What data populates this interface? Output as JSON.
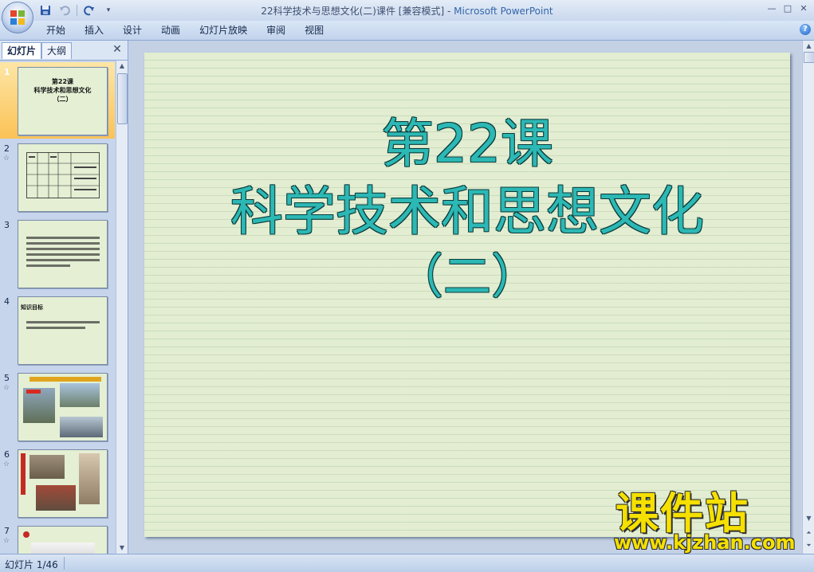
{
  "window": {
    "title_doc": "22科学技术与思想文化(二)课件 [兼容模式]",
    "title_sep": " - ",
    "title_app": "Microsoft PowerPoint",
    "minimize": "—",
    "maximize": "□",
    "close": "✕"
  },
  "quick_access": {
    "save_icon": "save-icon",
    "undo_icon": "undo-icon",
    "redo_icon": "redo-icon",
    "customize": "▾"
  },
  "ribbon": {
    "tabs": [
      "开始",
      "插入",
      "设计",
      "动画",
      "幻灯片放映",
      "审阅",
      "视图"
    ],
    "help": "?"
  },
  "left_pane": {
    "tab_slides": "幻灯片",
    "tab_outline": "大纲",
    "close": "✕",
    "transition_mark": "☆",
    "slides": [
      {
        "num": "1",
        "lines": [
          "第22课",
          "科学技术和思想文化",
          "（二）"
        ]
      },
      {
        "num": "2"
      },
      {
        "num": "3"
      },
      {
        "num": "4",
        "heading": "知识目标"
      },
      {
        "num": "5"
      },
      {
        "num": "6"
      },
      {
        "num": "7"
      }
    ]
  },
  "slide": {
    "line1": "第22课",
    "line2": "科学技术和思想文化",
    "line3": "（二）",
    "title_color": "#2cb8b4",
    "background": "#e2edd1"
  },
  "status": {
    "slide_indicator": "幻灯片 1/46"
  },
  "watermark": {
    "cn": "课件站",
    "url": "www.kjzhan.com"
  }
}
